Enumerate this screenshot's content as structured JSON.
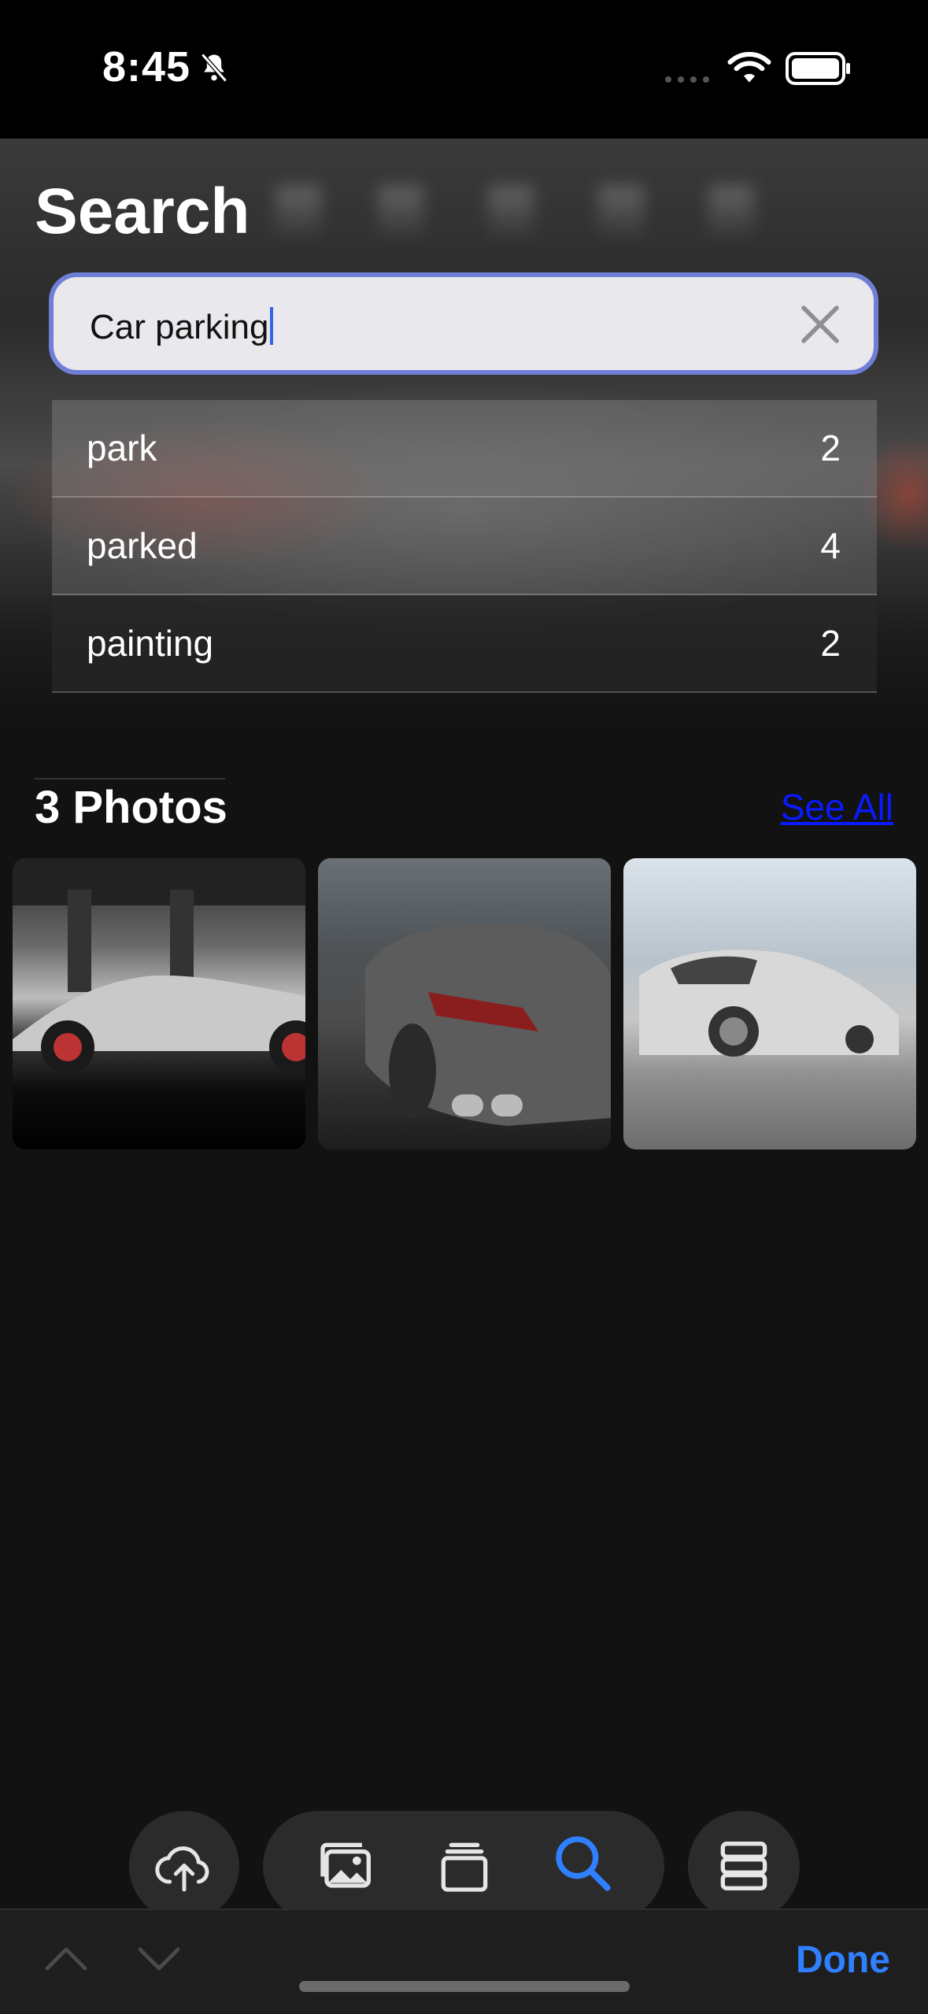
{
  "status": {
    "time": "8:45"
  },
  "header": {
    "title": "Search"
  },
  "search": {
    "value": "Car parking"
  },
  "suggestions": [
    {
      "term": "park",
      "count": "2"
    },
    {
      "term": "parked",
      "count": "4"
    },
    {
      "term": "painting",
      "count": "2"
    }
  ],
  "results": {
    "title": "3 Photos",
    "see_all": "See All"
  },
  "photos": [
    "silver-sports-car-under-bridge",
    "gray-coupe-rear",
    "silver-porsche-front"
  ],
  "toolbar": {
    "done_label": "Done"
  },
  "colors": {
    "accent": "#2f80ff",
    "link": "#0a1aff",
    "search_border": "#6f7fd6"
  },
  "icons": [
    "cloud-upload-icon",
    "photos-icon",
    "albums-icon",
    "search-icon",
    "menu-icon",
    "chevron-up-icon",
    "chevron-down-icon",
    "close-icon",
    "bell-slash-icon",
    "wifi-icon",
    "battery-icon"
  ]
}
